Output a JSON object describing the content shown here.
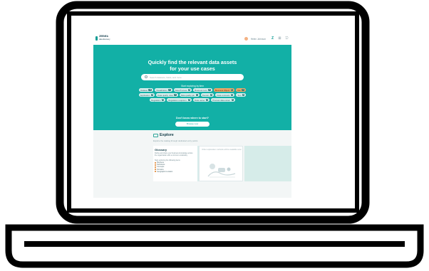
{
  "app": {
    "logo_name": "ZEENEA",
    "logo_tagline": "data discovery"
  },
  "topbar": {
    "user": "Helen Johnson"
  },
  "hero": {
    "title_line1": "Quickly find the relevant data assets",
    "title_line2": "for your use cases",
    "search_placeholder": "Search datasets, fields, and more",
    "tags_title": "Start exploring by item",
    "tags": [
      {
        "label": "Dataset",
        "count": "12",
        "highlight": false
      },
      {
        "label": "Visualization",
        "count": "4",
        "highlight": false
      },
      {
        "label": "Data Process",
        "count": "6",
        "highlight": false
      },
      {
        "label": "Business term",
        "count": "8",
        "highlight": false
      },
      {
        "label": "Business Object",
        "count": "3",
        "highlight": true
      },
      {
        "label": "Use",
        "count": "2",
        "highlight": true
      },
      {
        "label": "Application",
        "count": "5",
        "highlight": false
      },
      {
        "label": "Data quality rules",
        "count": "9",
        "highlight": false
      },
      {
        "label": "Data quality job",
        "count": "7",
        "highlight": false
      },
      {
        "label": "Domain",
        "count": "4",
        "highlight": false
      },
      {
        "label": "Data contracts",
        "count": "3",
        "highlight": false
      },
      {
        "label": "Tool",
        "count": "2",
        "highlight": false
      },
      {
        "label": "Regulation",
        "count": "6",
        "highlight": false
      },
      {
        "label": "Regulation requirem.",
        "count": "5",
        "highlight": false
      },
      {
        "label": "Data owner",
        "count": "4",
        "highlight": false
      },
      {
        "label": "Process data owner",
        "count": "3",
        "highlight": false
      }
    ],
    "dont_know_title": "Don't know where to start?",
    "dont_know_button": "Browse now"
  },
  "explore": {
    "title": "Explore",
    "subtitle": "Explore the catalog through dedicated entry points",
    "glossary": {
      "title": "Glossary",
      "description": "Define and share your business knowledge across the organization with a common vocabulary",
      "lead": "Start exploring the following items",
      "items": [
        "Business",
        "Definitions",
        "Concepts",
        "Domains",
        "Geographic Location"
      ]
    },
    "card2_text": "Other exploration methods will be available soon"
  },
  "colors": {
    "accent": "#12b0a6",
    "orange": "#f0a868",
    "dark": "#143e49"
  }
}
